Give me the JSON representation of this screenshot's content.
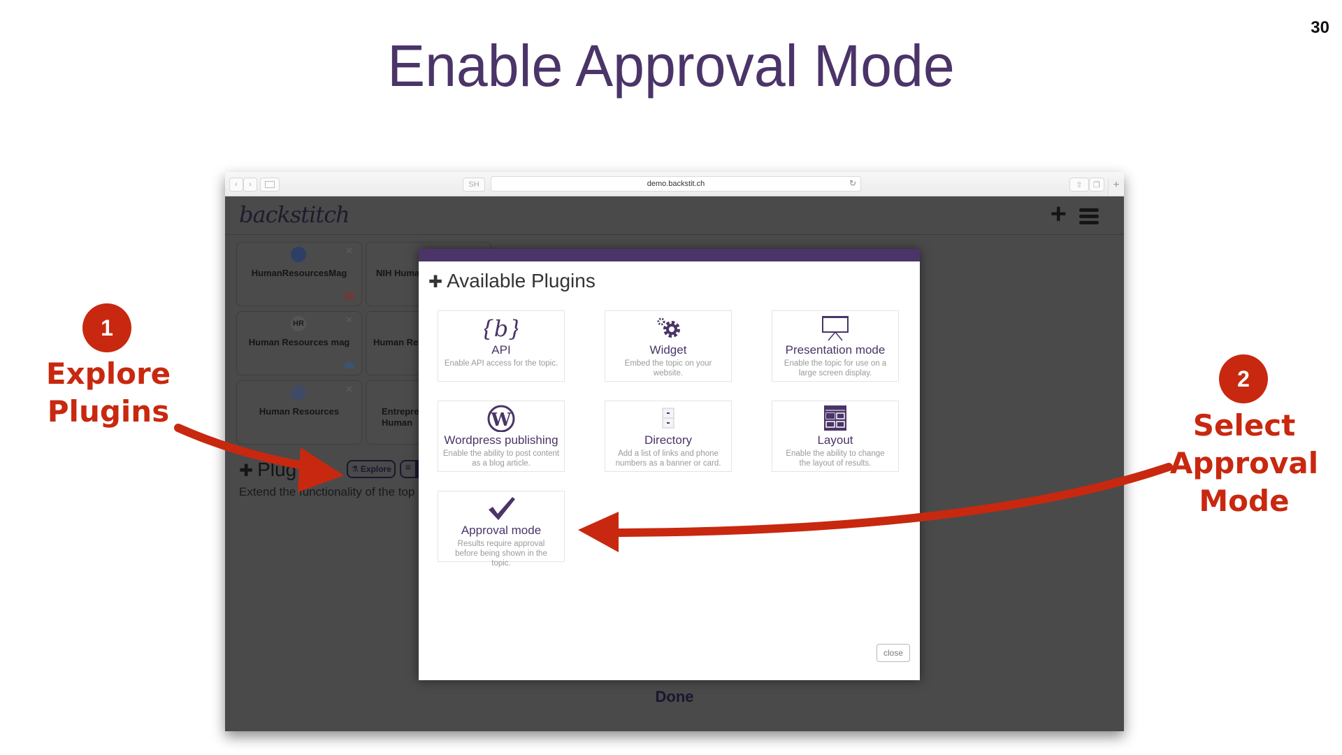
{
  "slide": {
    "title": "Enable Approval Mode",
    "page_number": "30"
  },
  "browser": {
    "url": "demo.backstit.ch",
    "sh_label": "SH",
    "reload_icon": "↻",
    "back_icon": "‹",
    "forward_icon": "›",
    "new_tab_icon": "+"
  },
  "app": {
    "logo": "backstitch",
    "add_icon": "+",
    "tiles": [
      {
        "name": "HumanResourcesMag",
        "icon": "person-icon",
        "badge": "youtube"
      },
      {
        "name": "NIH Huma",
        "icon": "feed-icon",
        "badge": ""
      },
      {
        "name": "Human Resources mag",
        "icon": "hr-logo",
        "badge": "twitter"
      },
      {
        "name": "Human Res",
        "icon": "feed-icon",
        "badge": ""
      },
      {
        "name": "Human Resources",
        "icon": "globe-icon",
        "badge": ""
      },
      {
        "name": "Entrepre\nHuman",
        "icon": "feed-icon",
        "badge": ""
      }
    ],
    "hr_logo_text": "HR",
    "tile_close": "✕",
    "plugins_heading": "Plug",
    "explore_label": "Explore",
    "plugins_subtitle": "Extend the functionality of the top",
    "done_label": "Done"
  },
  "modal": {
    "title": "Available Plugins",
    "close_label": "close",
    "plugins": [
      {
        "name": "API",
        "description": "Enable API access for the topic.",
        "icon": "api-braces-icon"
      },
      {
        "name": "Widget",
        "description": "Embed the topic on your website.",
        "icon": "gears-icon"
      },
      {
        "name": "Presentation mode",
        "description": "Enable the topic for use on a large screen display.",
        "icon": "projector-screen-icon"
      },
      {
        "name": "Wordpress publishing",
        "description": "Enable the ability to post content as a blog article.",
        "icon": "wordpress-icon"
      },
      {
        "name": "Directory",
        "description": "Add a list of links and phone numbers as a banner or card.",
        "icon": "cabinet-icon"
      },
      {
        "name": "Layout",
        "description": "Enable the ability to change the layout of results.",
        "icon": "layout-grid-icon"
      },
      {
        "name": "Approval mode",
        "description": "Results require approval before being shown in the topic.",
        "icon": "checkmark-icon"
      }
    ]
  },
  "annotations": {
    "step1": {
      "number": "1",
      "label": "Explore\nPlugins"
    },
    "step2": {
      "number": "2",
      "label": "Select\nApproval\nMode"
    },
    "color": "#c8280f"
  },
  "colors": {
    "brand": "#4a3468",
    "overlay": "#4a4a4a",
    "annotation": "#c8280f"
  }
}
